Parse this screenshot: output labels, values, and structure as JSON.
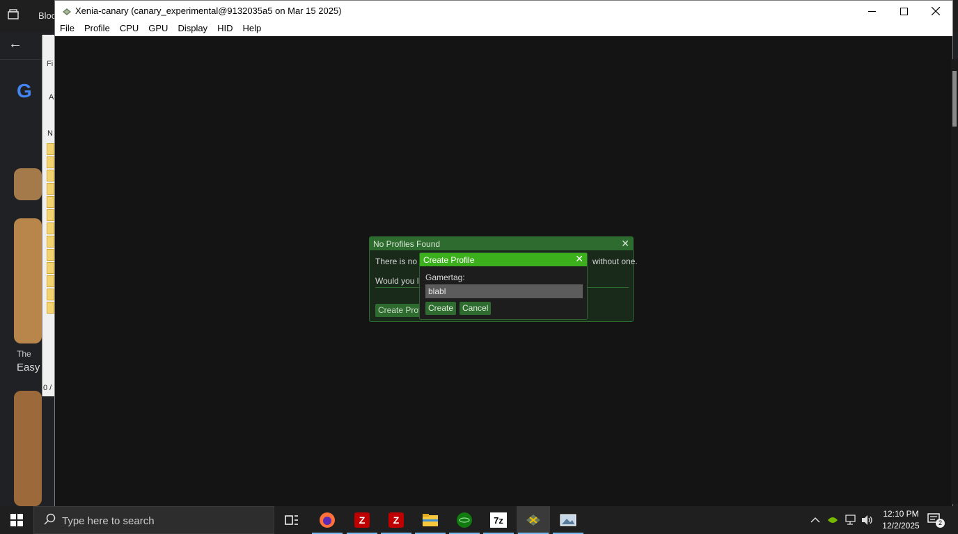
{
  "background_browser": {
    "tab_label": "Bloc",
    "caption_line1": "The",
    "caption_line2": "Easy"
  },
  "middle_window": {
    "labels": [
      "Fi",
      "A",
      "N"
    ],
    "status": "0 /"
  },
  "window": {
    "title": "Xenia-canary (canary_experimental@9132035a5 on Mar 15 2025)",
    "minimize_glyph": "—",
    "maximize_glyph": "☐",
    "close_glyph": "✕"
  },
  "menu": [
    "File",
    "Profile",
    "CPU",
    "GPU",
    "Display",
    "HID",
    "Help"
  ],
  "no_profiles_dialog": {
    "title": "No Profiles Found",
    "text_left": "There is no p",
    "text_right": "without one.",
    "text2": "Would you li",
    "button": "Create Profi",
    "close_glyph": "✕"
  },
  "create_profile_dialog": {
    "title": "Create Profile",
    "gamertag_label": "Gamertag:",
    "gamertag_value": "blabl",
    "create_button": "Create",
    "cancel_button": "Cancel",
    "close_glyph": "✕"
  },
  "taskbar": {
    "search_placeholder": "Type here to search",
    "apps": [
      "task-view",
      "firefox",
      "filezilla",
      "filezilla",
      "file-explorer",
      "xbox-app",
      "7zip",
      "xenia",
      "photos"
    ],
    "clock_time": "12:10 PM",
    "clock_date": "12/2/2025",
    "notification_count": "2",
    "accent_color": "#76b9ed"
  }
}
